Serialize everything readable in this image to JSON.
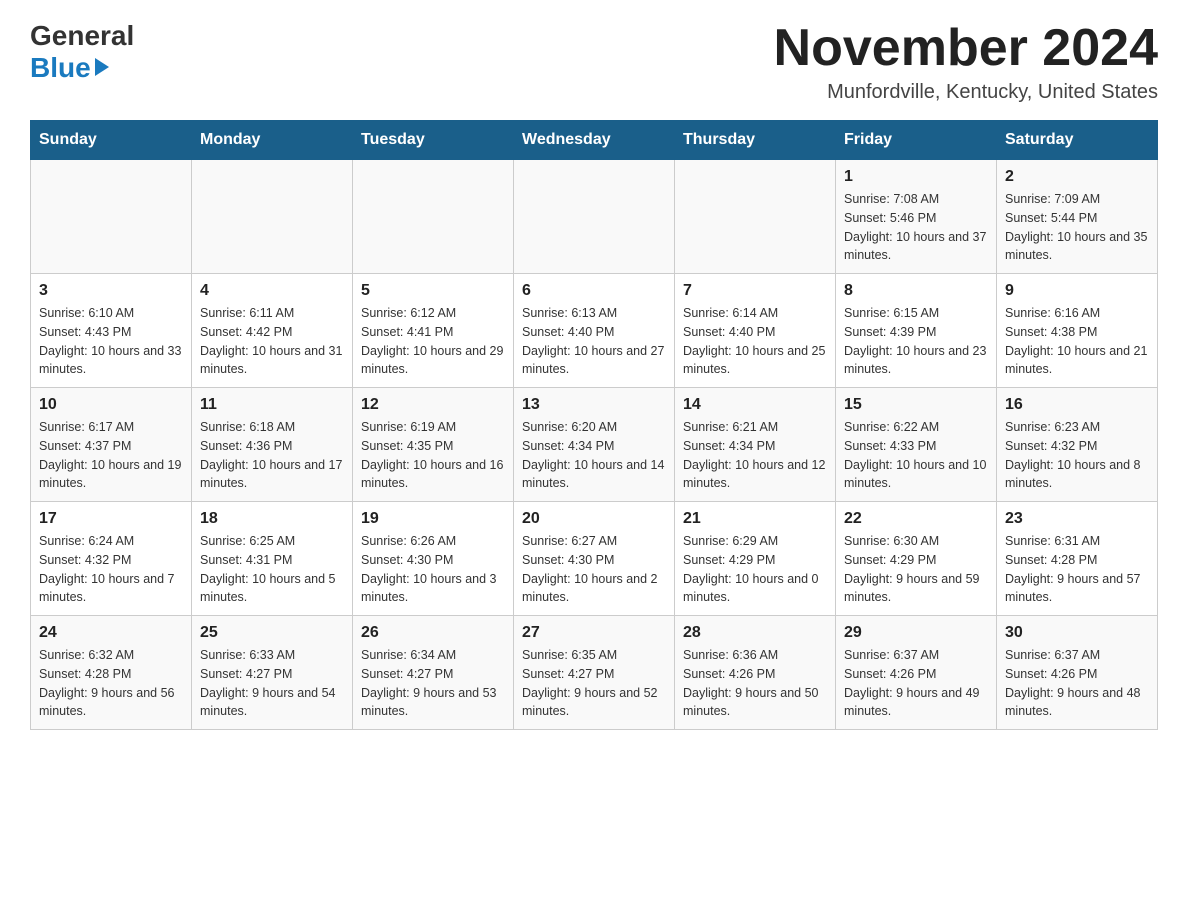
{
  "header": {
    "logo_general": "General",
    "logo_blue": "Blue",
    "month_title": "November 2024",
    "location": "Munfordville, Kentucky, United States"
  },
  "days_of_week": [
    "Sunday",
    "Monday",
    "Tuesday",
    "Wednesday",
    "Thursday",
    "Friday",
    "Saturday"
  ],
  "weeks": [
    [
      {
        "day": "",
        "info": ""
      },
      {
        "day": "",
        "info": ""
      },
      {
        "day": "",
        "info": ""
      },
      {
        "day": "",
        "info": ""
      },
      {
        "day": "",
        "info": ""
      },
      {
        "day": "1",
        "info": "Sunrise: 7:08 AM\nSunset: 5:46 PM\nDaylight: 10 hours and 37 minutes."
      },
      {
        "day": "2",
        "info": "Sunrise: 7:09 AM\nSunset: 5:44 PM\nDaylight: 10 hours and 35 minutes."
      }
    ],
    [
      {
        "day": "3",
        "info": "Sunrise: 6:10 AM\nSunset: 4:43 PM\nDaylight: 10 hours and 33 minutes."
      },
      {
        "day": "4",
        "info": "Sunrise: 6:11 AM\nSunset: 4:42 PM\nDaylight: 10 hours and 31 minutes."
      },
      {
        "day": "5",
        "info": "Sunrise: 6:12 AM\nSunset: 4:41 PM\nDaylight: 10 hours and 29 minutes."
      },
      {
        "day": "6",
        "info": "Sunrise: 6:13 AM\nSunset: 4:40 PM\nDaylight: 10 hours and 27 minutes."
      },
      {
        "day": "7",
        "info": "Sunrise: 6:14 AM\nSunset: 4:40 PM\nDaylight: 10 hours and 25 minutes."
      },
      {
        "day": "8",
        "info": "Sunrise: 6:15 AM\nSunset: 4:39 PM\nDaylight: 10 hours and 23 minutes."
      },
      {
        "day": "9",
        "info": "Sunrise: 6:16 AM\nSunset: 4:38 PM\nDaylight: 10 hours and 21 minutes."
      }
    ],
    [
      {
        "day": "10",
        "info": "Sunrise: 6:17 AM\nSunset: 4:37 PM\nDaylight: 10 hours and 19 minutes."
      },
      {
        "day": "11",
        "info": "Sunrise: 6:18 AM\nSunset: 4:36 PM\nDaylight: 10 hours and 17 minutes."
      },
      {
        "day": "12",
        "info": "Sunrise: 6:19 AM\nSunset: 4:35 PM\nDaylight: 10 hours and 16 minutes."
      },
      {
        "day": "13",
        "info": "Sunrise: 6:20 AM\nSunset: 4:34 PM\nDaylight: 10 hours and 14 minutes."
      },
      {
        "day": "14",
        "info": "Sunrise: 6:21 AM\nSunset: 4:34 PM\nDaylight: 10 hours and 12 minutes."
      },
      {
        "day": "15",
        "info": "Sunrise: 6:22 AM\nSunset: 4:33 PM\nDaylight: 10 hours and 10 minutes."
      },
      {
        "day": "16",
        "info": "Sunrise: 6:23 AM\nSunset: 4:32 PM\nDaylight: 10 hours and 8 minutes."
      }
    ],
    [
      {
        "day": "17",
        "info": "Sunrise: 6:24 AM\nSunset: 4:32 PM\nDaylight: 10 hours and 7 minutes."
      },
      {
        "day": "18",
        "info": "Sunrise: 6:25 AM\nSunset: 4:31 PM\nDaylight: 10 hours and 5 minutes."
      },
      {
        "day": "19",
        "info": "Sunrise: 6:26 AM\nSunset: 4:30 PM\nDaylight: 10 hours and 3 minutes."
      },
      {
        "day": "20",
        "info": "Sunrise: 6:27 AM\nSunset: 4:30 PM\nDaylight: 10 hours and 2 minutes."
      },
      {
        "day": "21",
        "info": "Sunrise: 6:29 AM\nSunset: 4:29 PM\nDaylight: 10 hours and 0 minutes."
      },
      {
        "day": "22",
        "info": "Sunrise: 6:30 AM\nSunset: 4:29 PM\nDaylight: 9 hours and 59 minutes."
      },
      {
        "day": "23",
        "info": "Sunrise: 6:31 AM\nSunset: 4:28 PM\nDaylight: 9 hours and 57 minutes."
      }
    ],
    [
      {
        "day": "24",
        "info": "Sunrise: 6:32 AM\nSunset: 4:28 PM\nDaylight: 9 hours and 56 minutes."
      },
      {
        "day": "25",
        "info": "Sunrise: 6:33 AM\nSunset: 4:27 PM\nDaylight: 9 hours and 54 minutes."
      },
      {
        "day": "26",
        "info": "Sunrise: 6:34 AM\nSunset: 4:27 PM\nDaylight: 9 hours and 53 minutes."
      },
      {
        "day": "27",
        "info": "Sunrise: 6:35 AM\nSunset: 4:27 PM\nDaylight: 9 hours and 52 minutes."
      },
      {
        "day": "28",
        "info": "Sunrise: 6:36 AM\nSunset: 4:26 PM\nDaylight: 9 hours and 50 minutes."
      },
      {
        "day": "29",
        "info": "Sunrise: 6:37 AM\nSunset: 4:26 PM\nDaylight: 9 hours and 49 minutes."
      },
      {
        "day": "30",
        "info": "Sunrise: 6:37 AM\nSunset: 4:26 PM\nDaylight: 9 hours and 48 minutes."
      }
    ]
  ]
}
